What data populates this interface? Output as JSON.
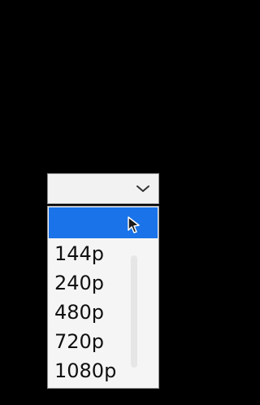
{
  "select": {
    "value": "",
    "chevron_icon": "chevron-down-icon"
  },
  "dropdown": {
    "highlighted_label": "",
    "options": [
      "144p",
      "240p",
      "480p",
      "720p",
      "1080p"
    ]
  },
  "colors": {
    "highlight": "#1a73e8",
    "background": "#000000",
    "list": "#f5f5f5"
  }
}
